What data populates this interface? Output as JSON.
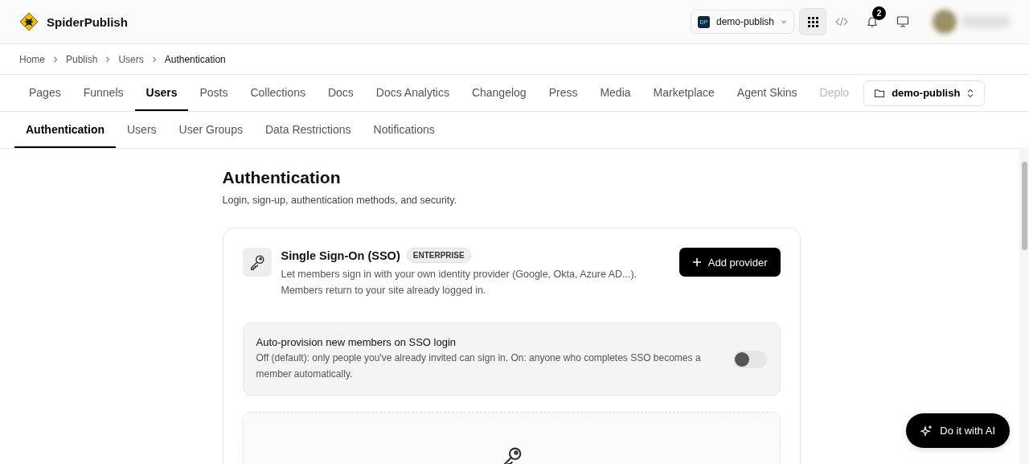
{
  "header": {
    "brand": "SpiderPublish",
    "workspace": {
      "initials": "DP",
      "name": "demo-publish"
    },
    "notifications": {
      "count": "2"
    }
  },
  "breadcrumb": [
    {
      "label": "Home",
      "current": false
    },
    {
      "label": "Publish",
      "current": false
    },
    {
      "label": "Users",
      "current": false
    },
    {
      "label": "Authentication",
      "current": true
    }
  ],
  "tabs": [
    {
      "label": "Pages",
      "selected": false
    },
    {
      "label": "Funnels",
      "selected": false
    },
    {
      "label": "Users",
      "selected": true
    },
    {
      "label": "Posts",
      "selected": false
    },
    {
      "label": "Collections",
      "selected": false
    },
    {
      "label": "Docs",
      "selected": false
    },
    {
      "label": "Docs Analytics",
      "selected": false
    },
    {
      "label": "Changelog",
      "selected": false
    },
    {
      "label": "Press",
      "selected": false
    },
    {
      "label": "Media",
      "selected": false
    },
    {
      "label": "Marketplace",
      "selected": false
    },
    {
      "label": "Agent Skins",
      "selected": false
    },
    {
      "label": "Deplo",
      "selected": false
    }
  ],
  "project_selector": "demo-publish",
  "subtabs": [
    {
      "label": "Authentication",
      "selected": true
    },
    {
      "label": "Users",
      "selected": false
    },
    {
      "label": "User Groups",
      "selected": false
    },
    {
      "label": "Data Restrictions",
      "selected": false
    },
    {
      "label": "Notifications",
      "selected": false
    }
  ],
  "page": {
    "title": "Authentication",
    "subtitle": "Login, sign-up, authentication methods, and security."
  },
  "sso_card": {
    "title": "Single Sign-On (SSO)",
    "badge": "ENTERPRISE",
    "description": "Let members sign in with your own identity provider (Google, Okta, Azure AD...).\nMembers return to your site already logged in.",
    "button": "Add provider",
    "setting": {
      "title": "Auto-provision new members on SSO login",
      "description": "Off (default): only people you've already invited can sign in. On: anyone who completes SSO becomes a member automatically.",
      "on": false
    }
  },
  "ai_button": "Do it with AI"
}
